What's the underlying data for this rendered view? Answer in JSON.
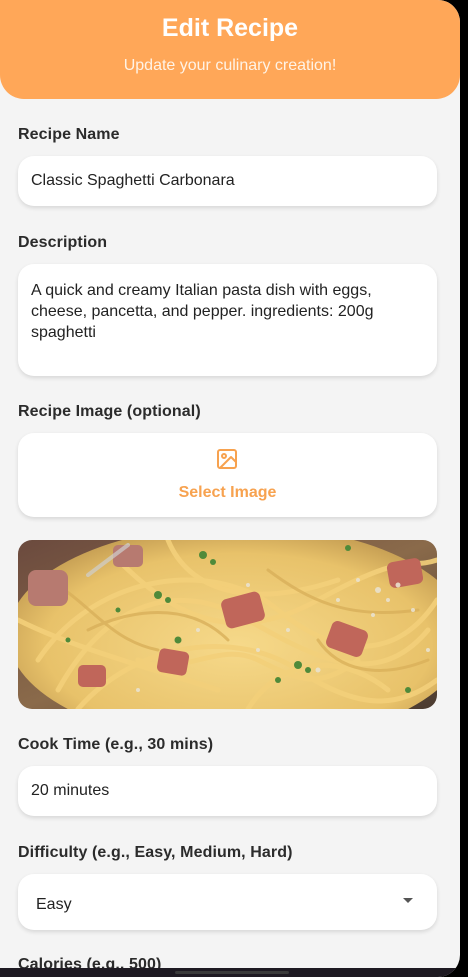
{
  "header": {
    "title": "Edit Recipe",
    "subtitle": "Update your culinary creation!"
  },
  "form": {
    "recipe_name": {
      "label": "Recipe Name",
      "value": "Classic Spaghetti Carbonara"
    },
    "description": {
      "label": "Description",
      "value": "A quick and creamy Italian pasta dish with eggs, cheese, pancetta, and pepper. ingredients: 200g spaghetti"
    },
    "image": {
      "label": "Recipe Image (optional)",
      "button_label": "Select Image",
      "icon": "image-icon"
    },
    "cook_time": {
      "label": "Cook Time (e.g., 30 mins)",
      "value": "20 minutes"
    },
    "difficulty": {
      "label": "Difficulty (e.g., Easy, Medium, Hard)",
      "value": "Easy",
      "icon": "dropdown-arrow-icon"
    },
    "calories": {
      "label": "Calories (e.g., 500)"
    }
  },
  "colors": {
    "accent": "#ffa758",
    "accent_text": "#f7a24f",
    "background": "#f4f4f4"
  }
}
